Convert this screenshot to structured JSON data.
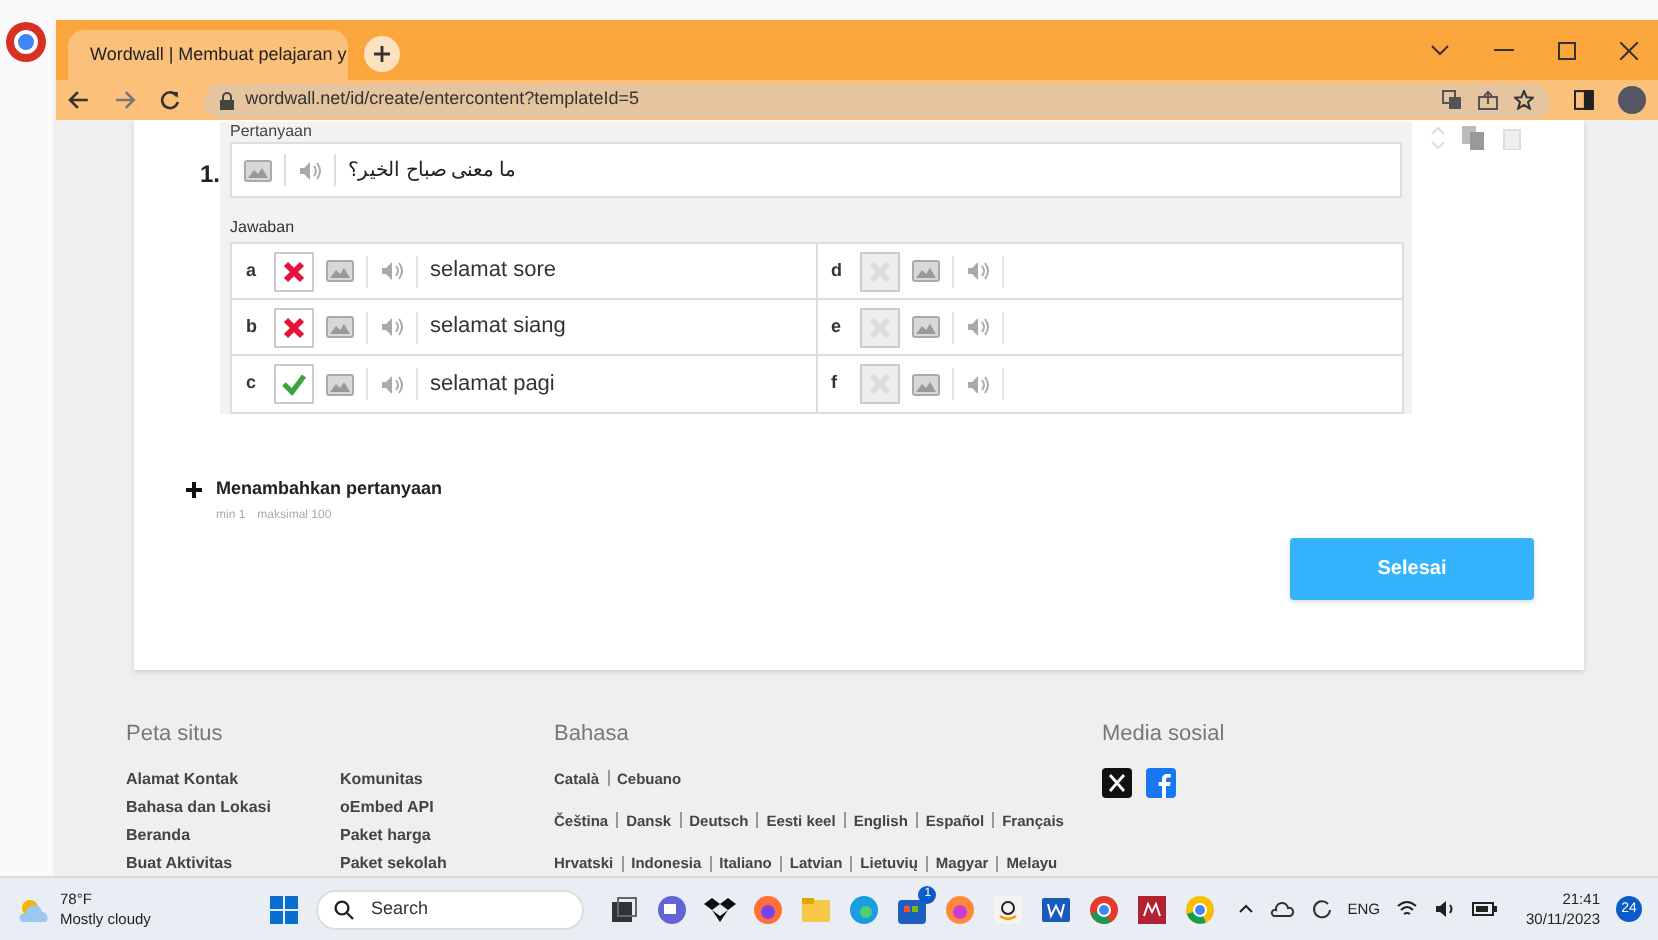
{
  "browser": {
    "tab_title": "Wordwall | Membuat pelajaran y",
    "url": "wordwall.net/id/create/entercontent?templateId=5"
  },
  "question": {
    "label": "Pertanyaan",
    "number": "1.",
    "text": "ما معنى صباح الخير؟"
  },
  "answers_label": "Jawaban",
  "answers": [
    {
      "letter": "a",
      "kind": "wrong",
      "text": "selamat sore"
    },
    {
      "letter": "d",
      "kind": "empty"
    },
    {
      "letter": "b",
      "kind": "wrong",
      "text": "selamat siang"
    },
    {
      "letter": "e",
      "kind": "empty"
    },
    {
      "letter": "c",
      "kind": "correct",
      "text": "selamat pagi"
    },
    {
      "letter": "f",
      "kind": "empty"
    }
  ],
  "add_question": {
    "label": "Menambahkan pertanyaan",
    "min": "min 1",
    "max": "maksimal 100"
  },
  "finish_button": "Selesai",
  "footer": {
    "sitemap": {
      "title": "Peta situs",
      "columns": [
        [
          "Alamat Kontak",
          "Bahasa dan Lokasi",
          "Beranda",
          "Buat Aktivitas"
        ],
        [
          "Komunitas",
          "oEmbed API",
          "Paket harga",
          "Paket sekolah"
        ]
      ]
    },
    "languages": {
      "title": "Bahasa",
      "lines": [
        [
          "Català",
          "Cebuano"
        ],
        [
          "Čeština",
          "Dansk",
          "Deutsch",
          "Eesti keel",
          "English",
          "Español",
          "Français"
        ],
        [
          "Hrvatski",
          "Indonesia",
          "Italiano",
          "Latvian",
          "Lietuvių",
          "Magyar",
          "Melayu"
        ]
      ]
    },
    "social": {
      "title": "Media sosial"
    }
  },
  "taskbar": {
    "temperature": "78°F",
    "weather": "Mostly cloudy",
    "search_placeholder": "Search",
    "store_badge": "1",
    "language": "ENG",
    "time": "21:41",
    "date": "30/11/2023",
    "notifications": "24"
  }
}
